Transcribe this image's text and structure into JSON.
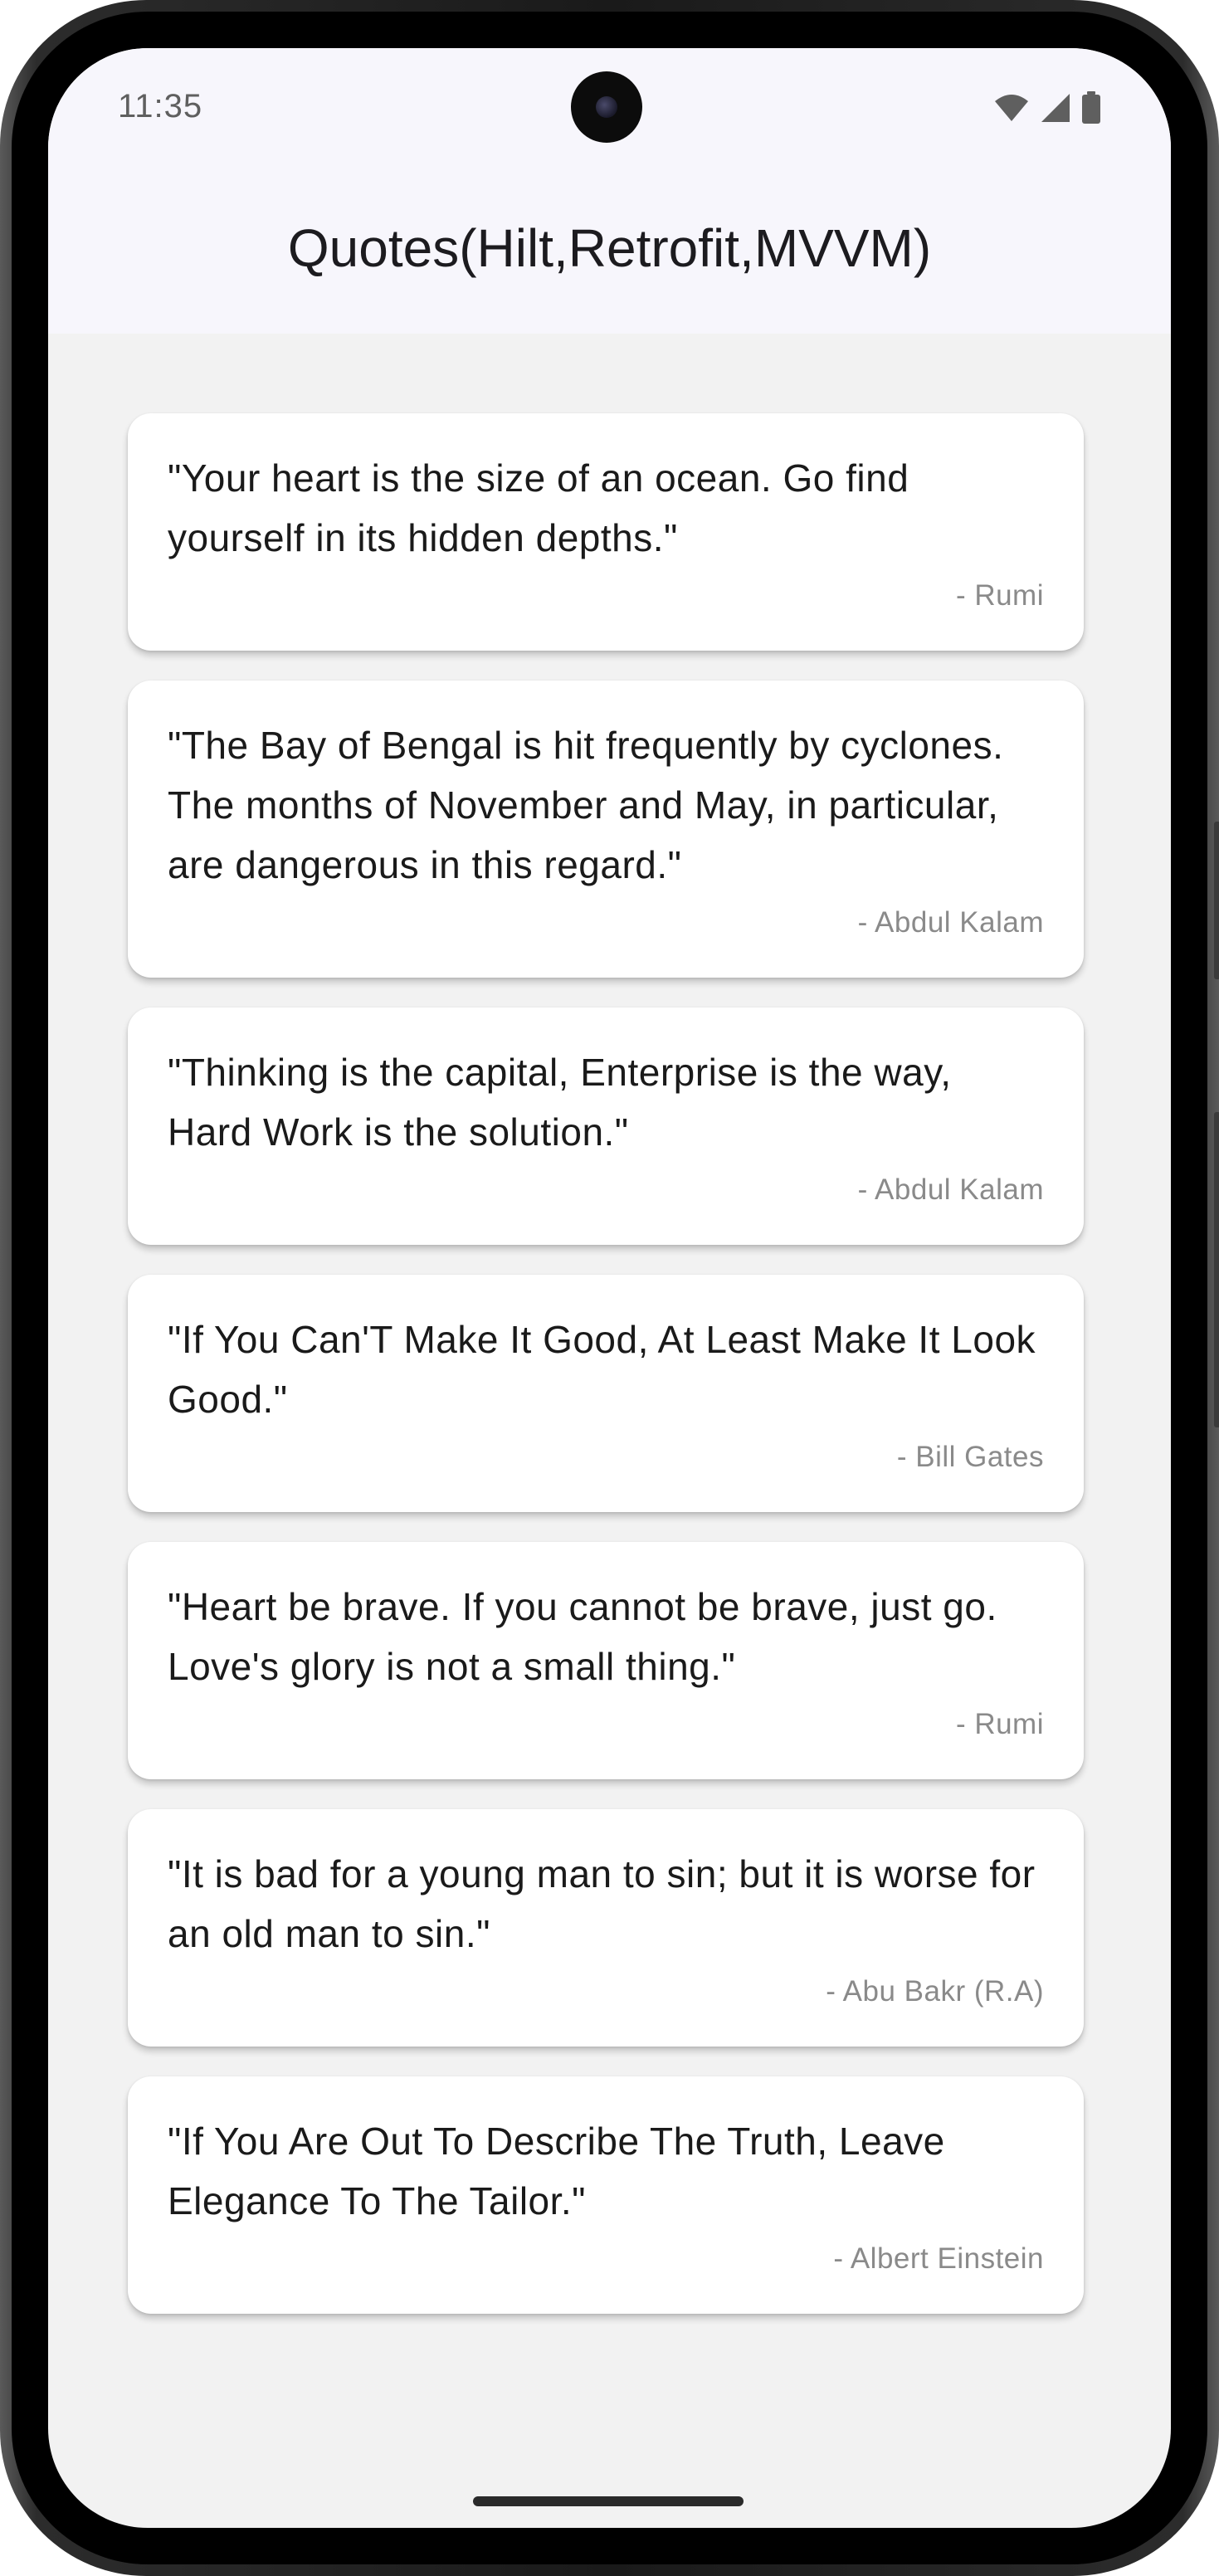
{
  "status_bar": {
    "time": "11:35",
    "icons": [
      "wifi-icon",
      "cellular-signal-icon",
      "battery-icon"
    ]
  },
  "header": {
    "title": "Quotes(Hilt,Retrofit,MVVM)"
  },
  "quotes": [
    {
      "text": "\"Your heart is the size of an ocean. Go find yourself in its hidden depths.\"",
      "author": "- Rumi"
    },
    {
      "text": "\"The Bay of Bengal is hit frequently by cyclones. The months of November and May, in particular, are dangerous in this regard.\"",
      "author": "- Abdul Kalam"
    },
    {
      "text": "\"Thinking is the capital, Enterprise is the way, Hard Work is the solution.\"",
      "author": "- Abdul Kalam"
    },
    {
      "text": "\"If You Can'T Make It Good, At Least Make It Look Good.\"",
      "author": "- Bill Gates"
    },
    {
      "text": "\"Heart be brave. If you cannot be brave, just go. Love's glory is not a small thing.\"",
      "author": "- Rumi"
    },
    {
      "text": "\"It is bad for a young man to sin; but it is worse for an old man to sin.\"",
      "author": "- Abu Bakr (R.A)"
    },
    {
      "text": "\"If You Are Out To Describe The Truth, Leave Elegance To The Tailor.\"",
      "author": "- Albert Einstein"
    }
  ],
  "colors": {
    "header_background": "#f7f6fc",
    "list_background": "#f2f2f2",
    "card_background": "#ffffff",
    "quote_text": "#1a1a1a",
    "author_text": "#8a8a8a"
  }
}
